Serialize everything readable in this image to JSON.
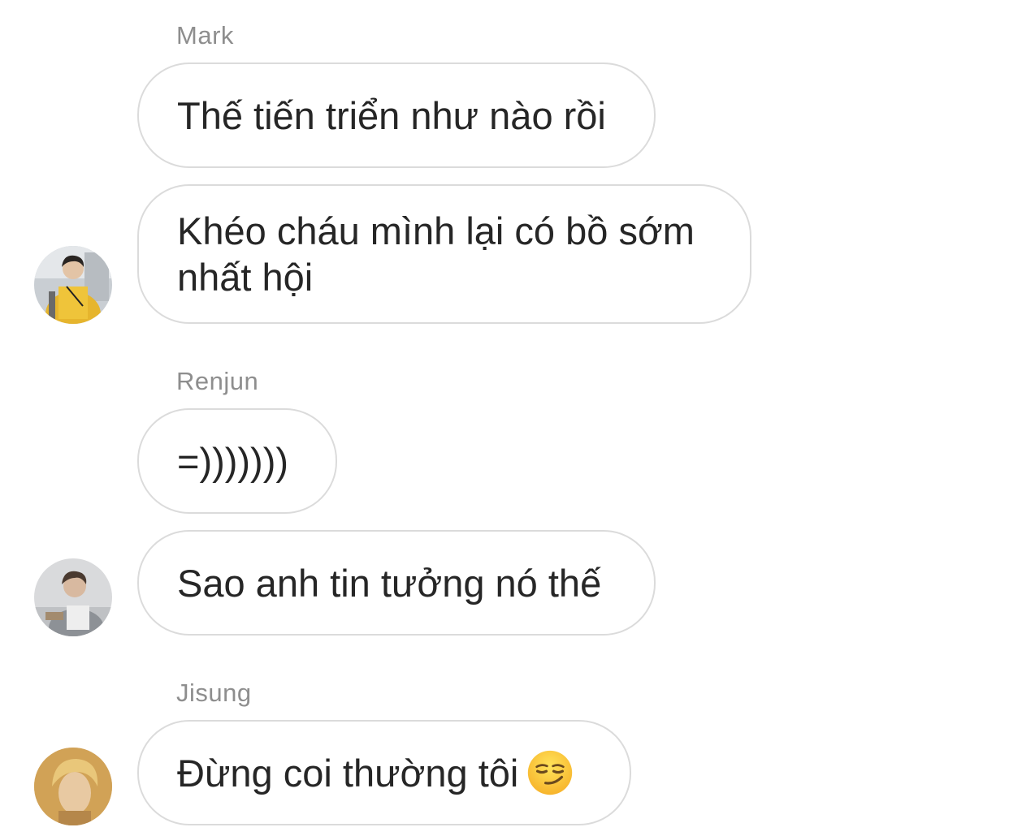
{
  "chat": {
    "groups": [
      {
        "sender": "Mark",
        "messages": [
          "Thế tiến triển như nào rồi",
          "Khéo cháu mình lại có bồ sớm nhất hội"
        ]
      },
      {
        "sender": "Renjun",
        "messages": [
          "=)))))))",
          "Sao anh tin tưởng nó thế"
        ]
      },
      {
        "sender": "Jisung",
        "messages": [
          "Đừng coi thường tôi"
        ],
        "emoji": "smirking-face"
      }
    ]
  },
  "colors": {
    "bubble_border": "#dbdbdb",
    "sender_label": "#8e8e8e",
    "message_text": "#262626",
    "background": "#ffffff"
  }
}
